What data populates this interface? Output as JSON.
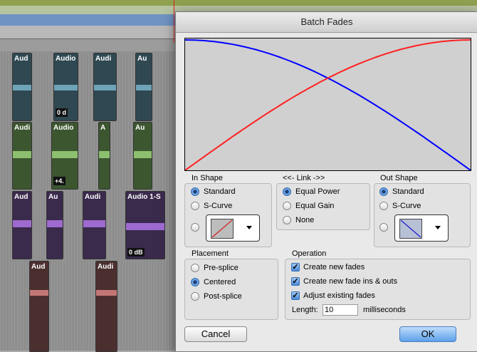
{
  "dialog": {
    "title": "Batch Fades",
    "in_shape": {
      "label": "In Shape",
      "options": [
        "Standard",
        "S-Curve"
      ],
      "selected": "Standard"
    },
    "link": {
      "label": "<<- Link ->>",
      "options": [
        "Equal Power",
        "Equal Gain",
        "None"
      ],
      "selected": "Equal Power"
    },
    "out_shape": {
      "label": "Out Shape",
      "options": [
        "Standard",
        "S-Curve"
      ],
      "selected": "Standard"
    },
    "placement": {
      "label": "Placement",
      "options": [
        "Pre-splice",
        "Centered",
        "Post-splice"
      ],
      "selected": "Centered"
    },
    "operation": {
      "label": "Operation",
      "checks": [
        {
          "label": "Create new fades",
          "checked": true
        },
        {
          "label": "Create new fade ins & outs",
          "checked": true
        },
        {
          "label": "Adjust existing fades",
          "checked": true
        }
      ],
      "length_label": "Length:",
      "length_value": "10",
      "length_unit": "milliseconds"
    },
    "cancel_label": "Cancel",
    "ok_label": "OK",
    "curve_colors": {
      "fade_out": "#0000ff",
      "fade_in": "#ff2020"
    }
  },
  "tracks": [
    {
      "color": "#304a55",
      "band": "#6ea3b8",
      "clips": [
        {
          "name": "Aud",
          "vol": ""
        },
        {
          "name": "Audio",
          "vol": "0 d"
        },
        {
          "name": "Audi",
          "vol": ""
        },
        {
          "name": "Au",
          "vol": ""
        }
      ]
    },
    {
      "color": "#3f5a33",
      "band": "#8cbf6e",
      "clips": [
        {
          "name": "Audi",
          "vol": ""
        },
        {
          "name": "Audio",
          "vol": "+4."
        },
        {
          "name": "A",
          "vol": ""
        },
        {
          "name": "Au",
          "vol": ""
        }
      ]
    },
    {
      "color": "#3c2c4e",
      "band": "#9e6ad0",
      "clips": [
        {
          "name": "Aud",
          "vol": ""
        },
        {
          "name": "Au",
          "vol": ""
        },
        {
          "name": "Audi",
          "vol": ""
        },
        {
          "name": "Audio 1-S",
          "vol": "0 dB"
        }
      ]
    },
    {
      "color": "#4e3030",
      "band": "#c47676",
      "clips": [
        {
          "name": "Aud",
          "vol": ""
        },
        {
          "name": "Audi",
          "vol": ""
        }
      ]
    }
  ]
}
